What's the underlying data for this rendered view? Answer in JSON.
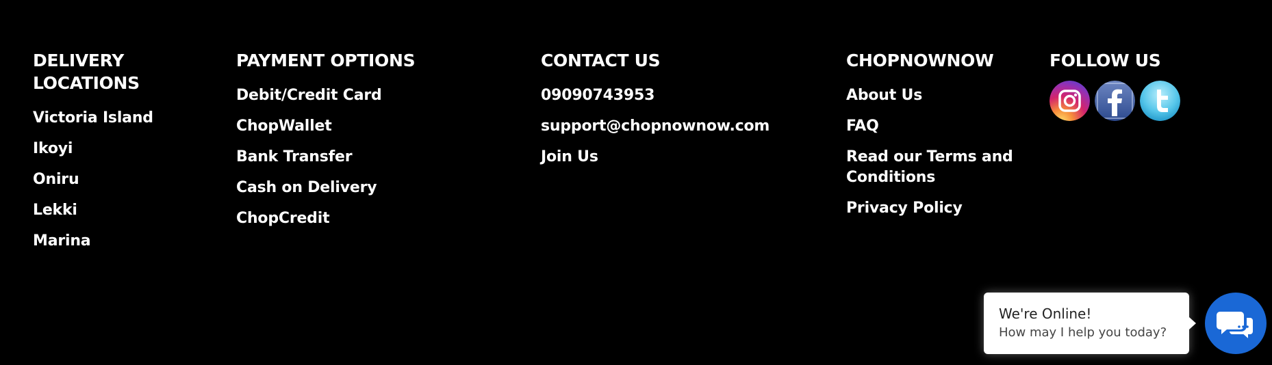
{
  "footer": {
    "delivery": {
      "heading": "DELIVERY LOCATIONS",
      "items": [
        "Victoria Island",
        "Ikoyi",
        "Oniru",
        "Lekki",
        "Marina"
      ]
    },
    "payment": {
      "heading": "PAYMENT OPTIONS",
      "items": [
        "Debit/Credit Card",
        "ChopWallet",
        "Bank Transfer",
        "Cash on Delivery",
        "ChopCredit"
      ]
    },
    "contact": {
      "heading": "CONTACT US",
      "phone": "09090743953",
      "email": "support@chopnownow.com",
      "join": "Join Us"
    },
    "chopnownow": {
      "heading": "CHOPNOWNOW",
      "items": [
        "About Us",
        "FAQ",
        "Read our Terms and Conditions",
        "Privacy Policy"
      ]
    },
    "follow": {
      "heading": "FOLLOW US",
      "icons": [
        "instagram-icon",
        "facebook-icon",
        "twitter-icon"
      ]
    }
  },
  "chat": {
    "title": "We're Online!",
    "subtitle": "How may I help you today?",
    "button_icon": "chat-bubbles-icon",
    "accent": "#1a68d6"
  },
  "colors": {
    "background": "#000000",
    "text": "#ffffff"
  }
}
